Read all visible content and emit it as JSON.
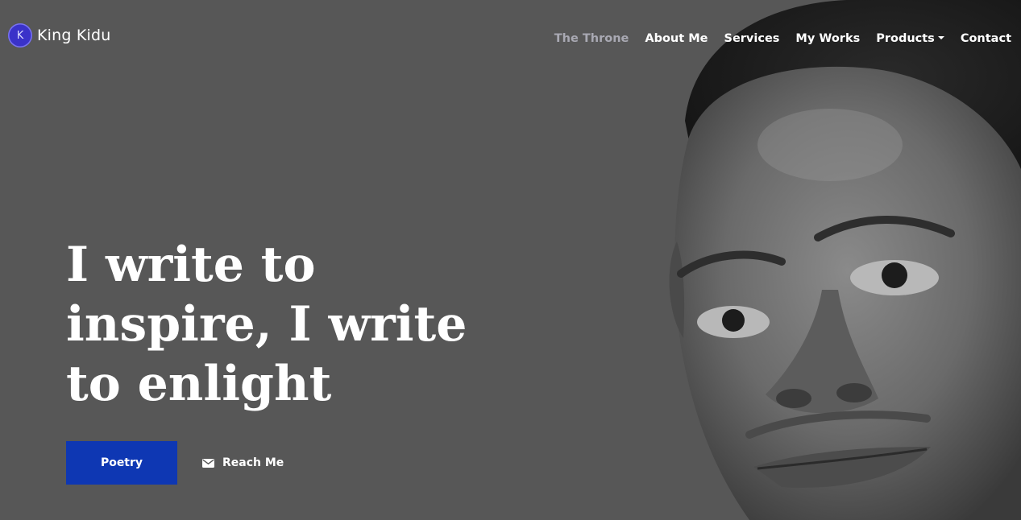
{
  "brand": {
    "logo_letter": "K",
    "name": "King Kidu"
  },
  "nav": {
    "items": [
      {
        "label": "The Throne",
        "active": true
      },
      {
        "label": "About Me"
      },
      {
        "label": "Services"
      },
      {
        "label": "My Works"
      },
      {
        "label": "Products",
        "dropdown": true
      },
      {
        "label": "Contact"
      }
    ]
  },
  "hero": {
    "headline": "I write to inspire, I write to enlight",
    "primary_button": "Poetry",
    "secondary_button": "Reach Me",
    "secondary_icon": "envelope-icon"
  },
  "colors": {
    "background": "#575757",
    "primary_button": "#0e37b3",
    "brand_logo": "#3a32c9",
    "nav_active": "#a9a9b3"
  }
}
